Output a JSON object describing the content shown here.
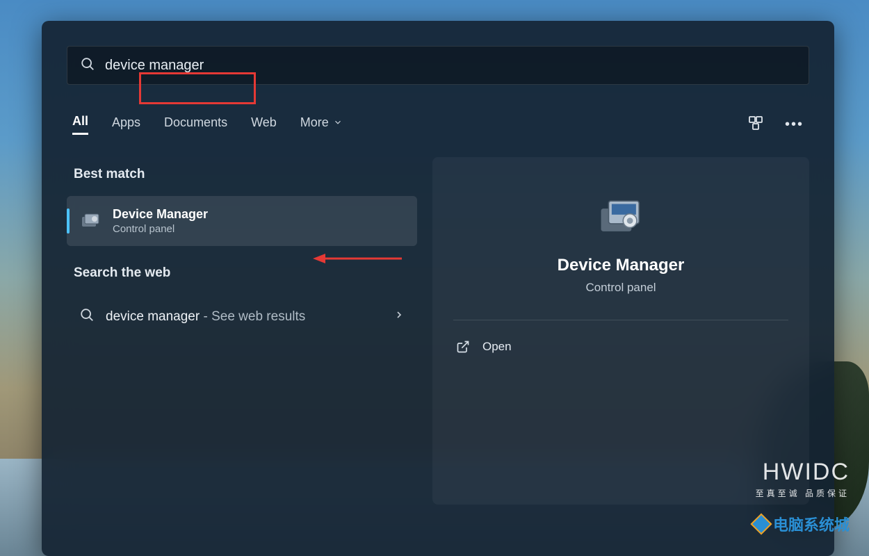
{
  "search": {
    "value": "device manager"
  },
  "tabs": {
    "all": "All",
    "apps": "Apps",
    "documents": "Documents",
    "web": "Web",
    "more": "More"
  },
  "left": {
    "best_match": "Best match",
    "result_title": "Device Manager",
    "result_sub": "Control panel",
    "search_web": "Search the web",
    "web_query": "device manager",
    "web_suffix": " - See web results"
  },
  "detail": {
    "title": "Device Manager",
    "sub": "Control panel",
    "open": "Open"
  },
  "watermark": {
    "brand": "HWIDC",
    "tagline": "至真至诚 品质保证",
    "site": "电脑系统城"
  }
}
